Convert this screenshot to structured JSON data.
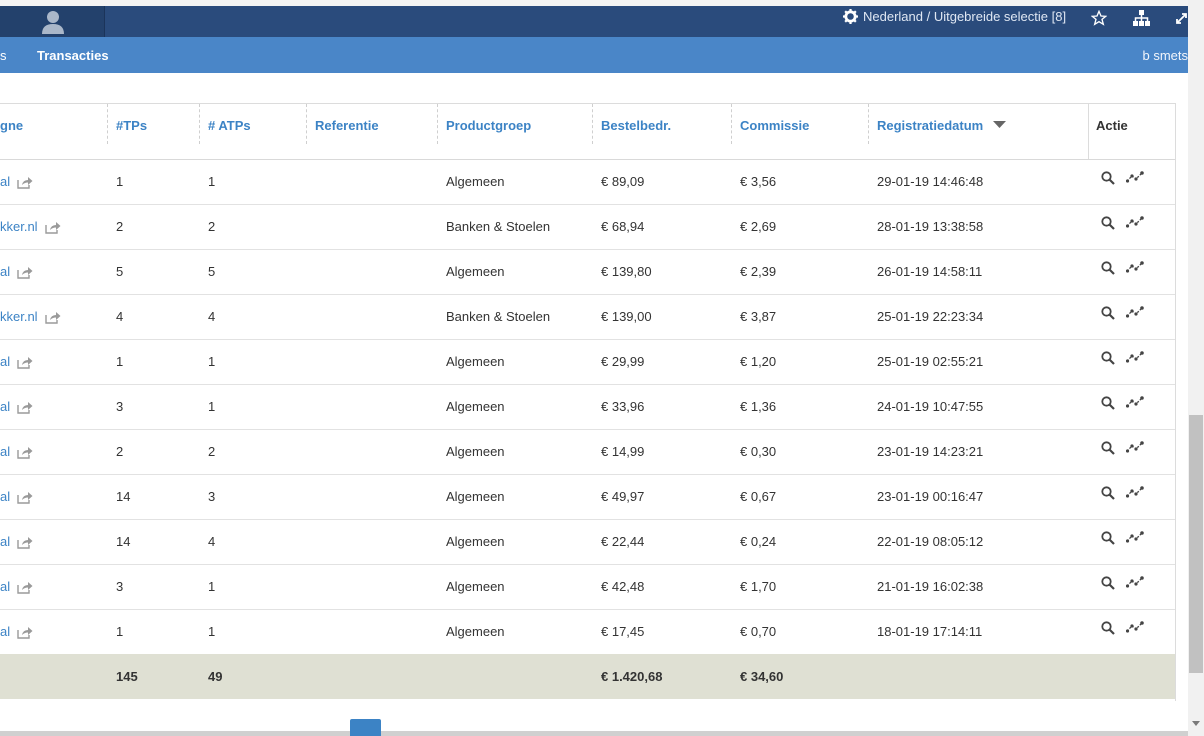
{
  "header": {
    "region_label": "Nederland / Uitgebreide selectie [8]"
  },
  "nav": {
    "partial_item": "s",
    "active_item": "Transacties",
    "user_name": "b smets"
  },
  "table": {
    "columns": [
      "gne",
      "#TPs",
      "# ATPs",
      "Referentie",
      "Productgroep",
      "Bestelbedr.",
      "Commissie",
      "Registratiedatum",
      "Actie"
    ],
    "rows": [
      {
        "campaign": "al",
        "tps": "1",
        "atps": "1",
        "referentie": "",
        "productgroep": "Algemeen",
        "bestelbedrag": "€ 89,09",
        "commissie": "€ 3,56",
        "datum": "29-01-19 14:46:48"
      },
      {
        "campaign": "kker.nl",
        "tps": "2",
        "atps": "2",
        "referentie": "",
        "productgroep": "Banken & Stoelen",
        "bestelbedrag": "€ 68,94",
        "commissie": "€ 2,69",
        "datum": "28-01-19 13:38:58"
      },
      {
        "campaign": "al",
        "tps": "5",
        "atps": "5",
        "referentie": "",
        "productgroep": "Algemeen",
        "bestelbedrag": "€ 139,80",
        "commissie": "€ 2,39",
        "datum": "26-01-19 14:58:11"
      },
      {
        "campaign": "kker.nl",
        "tps": "4",
        "atps": "4",
        "referentie": "",
        "productgroep": "Banken & Stoelen",
        "bestelbedrag": "€ 139,00",
        "commissie": "€ 3,87",
        "datum": "25-01-19 22:23:34"
      },
      {
        "campaign": "al",
        "tps": "1",
        "atps": "1",
        "referentie": "",
        "productgroep": "Algemeen",
        "bestelbedrag": "€ 29,99",
        "commissie": "€ 1,20",
        "datum": "25-01-19 02:55:21"
      },
      {
        "campaign": "al",
        "tps": "3",
        "atps": "1",
        "referentie": "",
        "productgroep": "Algemeen",
        "bestelbedrag": "€ 33,96",
        "commissie": "€ 1,36",
        "datum": "24-01-19 10:47:55"
      },
      {
        "campaign": "al",
        "tps": "2",
        "atps": "2",
        "referentie": "",
        "productgroep": "Algemeen",
        "bestelbedrag": "€ 14,99",
        "commissie": "€ 0,30",
        "datum": "23-01-19 14:23:21"
      },
      {
        "campaign": "al",
        "tps": "14",
        "atps": "3",
        "referentie": "",
        "productgroep": "Algemeen",
        "bestelbedrag": "€ 49,97",
        "commissie": "€ 0,67",
        "datum": "23-01-19 00:16:47"
      },
      {
        "campaign": "al",
        "tps": "14",
        "atps": "4",
        "referentie": "",
        "productgroep": "Algemeen",
        "bestelbedrag": "€ 22,44",
        "commissie": "€ 0,24",
        "datum": "22-01-19 08:05:12"
      },
      {
        "campaign": "al",
        "tps": "3",
        "atps": "1",
        "referentie": "",
        "productgroep": "Algemeen",
        "bestelbedrag": "€ 42,48",
        "commissie": "€ 1,70",
        "datum": "21-01-19 16:02:38"
      },
      {
        "campaign": "al",
        "tps": "1",
        "atps": "1",
        "referentie": "",
        "productgroep": "Algemeen",
        "bestelbedrag": "€ 17,45",
        "commissie": "€ 0,70",
        "datum": "18-01-19 17:14:11"
      }
    ],
    "totals": {
      "tps": "145",
      "atps": "49",
      "bestelbedrag": "€ 1.420,68",
      "commissie": "€ 34,60"
    }
  },
  "icons": [
    "user-icon",
    "gear-icon",
    "star-icon",
    "sitemap-icon",
    "expand-icon",
    "share-icon",
    "search-icon",
    "trend-icon",
    "sort-desc-icon"
  ],
  "colors": {
    "topbar": "#2a4b7c",
    "navbar": "#4a86c8",
    "link": "#3c83c5",
    "totals": "#dfe0d3"
  }
}
